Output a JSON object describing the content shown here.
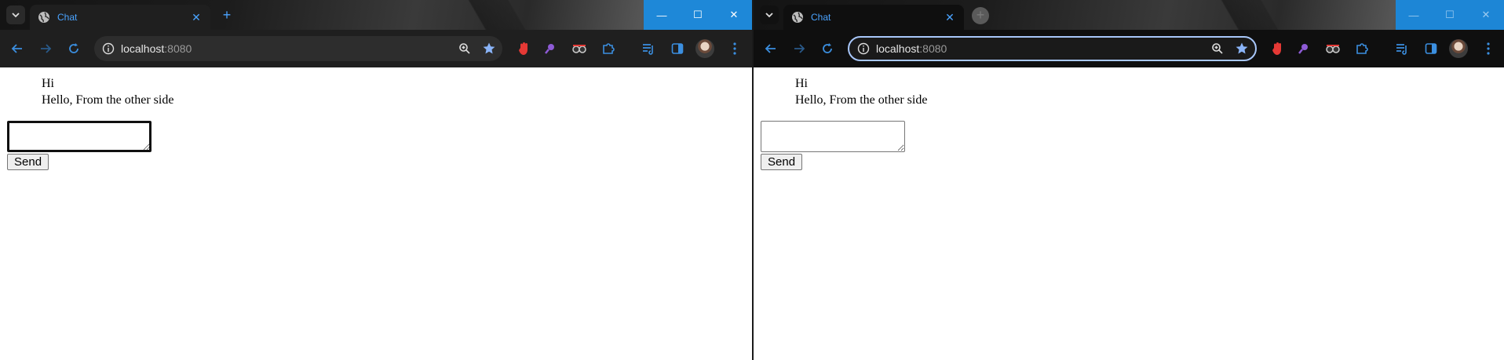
{
  "windows": [
    {
      "tab_title": "Chat",
      "url_host": "localhost",
      "url_port": ":8080",
      "messages": [
        "Hi",
        "Hello, From the other side"
      ],
      "input_value": "",
      "send_label": "Send"
    },
    {
      "tab_title": "Chat",
      "url_host": "localhost",
      "url_port": ":8080",
      "messages": [
        "Hi",
        "Hello, From the other side"
      ],
      "input_value": "",
      "send_label": "Send"
    }
  ],
  "colors": {
    "accent": "#1e88d8",
    "tab_text": "#4aa3ff",
    "toolbar_bg": "#1f1f1f"
  },
  "icons": [
    "tab-search-icon",
    "globe-icon",
    "close-icon",
    "new-tab-icon",
    "minimize-icon",
    "maximize-icon",
    "window-close-icon",
    "back-icon",
    "forward-icon",
    "reload-icon",
    "site-info-icon",
    "zoom-icon",
    "bookmark-star-icon",
    "extension-icon",
    "reading-list-icon",
    "side-panel-icon",
    "profile-avatar",
    "menu-icon"
  ]
}
